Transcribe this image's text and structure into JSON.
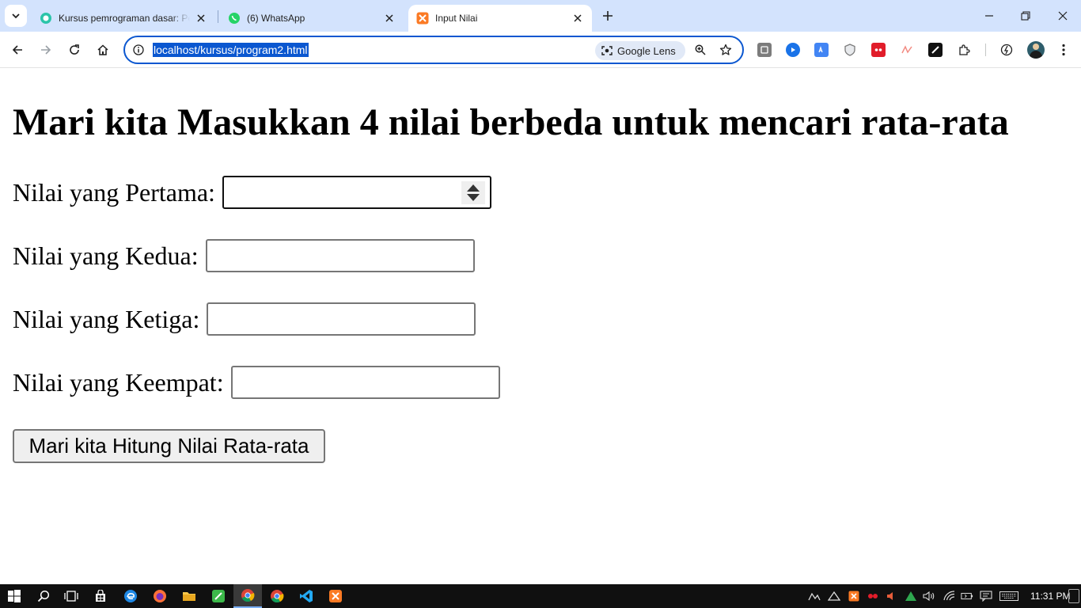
{
  "browser": {
    "tabs": [
      {
        "title": "Kursus pemrograman dasar: Pel",
        "active": false,
        "favicon": "codepolitan-favicon"
      },
      {
        "title": "(6) WhatsApp",
        "active": false,
        "favicon": "whatsapp-favicon"
      },
      {
        "title": "Input Nilai",
        "active": true,
        "favicon": "xampp-favicon"
      }
    ],
    "address_bar": {
      "url": "localhost/kursus/program2.html",
      "lens_label": "Google Lens"
    }
  },
  "page": {
    "heading": "Mari kita Masukkan 4 nilai berbeda untuk mencari rata-rata",
    "fields": [
      {
        "label": "Nilai yang Pertama:",
        "value": "",
        "type": "number"
      },
      {
        "label": "Nilai yang Kedua:",
        "value": "",
        "type": "text"
      },
      {
        "label": "Nilai yang Ketiga:",
        "value": "",
        "type": "text"
      },
      {
        "label": "Nilai yang Keempat:",
        "value": "",
        "type": "text"
      }
    ],
    "submit_label": "Mari kita Hitung Nilai Rata-rata"
  },
  "taskbar": {
    "clock": "11:31 PM"
  },
  "colors": {
    "tabstrip": "#d3e3fd",
    "accent": "#0b57d0",
    "taskbar": "#101010"
  }
}
